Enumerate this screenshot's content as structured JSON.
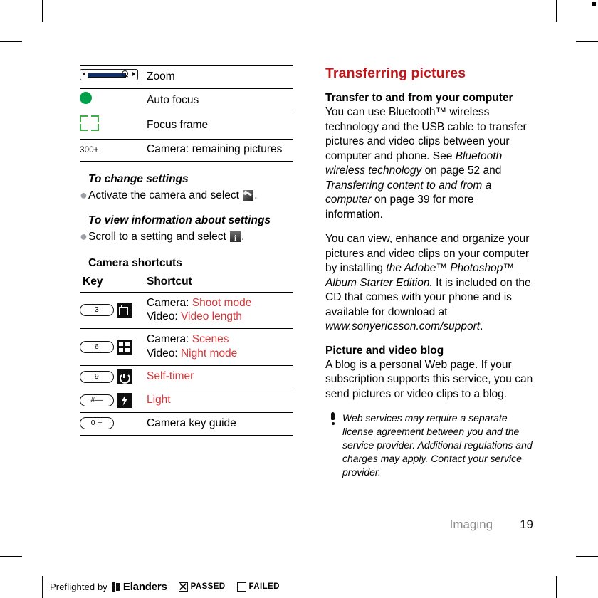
{
  "page": {
    "section_label": "Imaging",
    "page_number": "19"
  },
  "legend_table": {
    "rows": [
      {
        "icon": "zoom-slider-icon",
        "label": "Zoom"
      },
      {
        "icon": "green-dot-icon",
        "label": "Auto focus"
      },
      {
        "icon": "focus-frame-icon",
        "label": "Focus frame"
      },
      {
        "icon": "remaining-count-icon",
        "icon_text": "300+",
        "label": "Camera: remaining pictures"
      }
    ]
  },
  "procedures": [
    {
      "heading": "To change settings",
      "text_before": "Activate the camera and select ",
      "glyph": "wrench-icon",
      "text_after": "."
    },
    {
      "heading": "To view information about settings",
      "text_before": "Scroll to a setting and select ",
      "glyph": "info-icon",
      "text_after": "."
    }
  ],
  "shortcuts": {
    "title": "Camera shortcuts",
    "columns": [
      "Key",
      "Shortcut"
    ],
    "rows": [
      {
        "key": "3",
        "key_icon": "shoot-mode-icon",
        "lines": [
          {
            "label": "Camera:",
            "value": "Shoot mode"
          },
          {
            "label": "Video:",
            "value": "Video length"
          }
        ]
      },
      {
        "key": "6",
        "key_icon": "scenes-grid-icon",
        "lines": [
          {
            "label": "Camera:",
            "value": "Scenes"
          },
          {
            "label": "Video:",
            "value": "Night mode"
          }
        ]
      },
      {
        "key": "9",
        "key_icon": "self-timer-icon",
        "lines": [
          {
            "label": "",
            "value": "Self-timer"
          }
        ]
      },
      {
        "key": "#—",
        "key_icon": "light-bolt-icon",
        "lines": [
          {
            "label": "",
            "value": "Light"
          }
        ]
      },
      {
        "key": "0 +",
        "key_icon": "",
        "lines": [
          {
            "label": "Camera key guide",
            "value": ""
          }
        ]
      }
    ]
  },
  "right_column": {
    "chapter_title": "Transferring pictures",
    "section1": {
      "heading": "Transfer to and from your computer",
      "paragraph1_a": "You can use Bluetooth™ wireless technology and the USB cable to transfer pictures and video clips between your computer and phone. See ",
      "paragraph1_it1": "Bluetooth wireless technology",
      "paragraph1_b": " on page 52 and ",
      "paragraph1_it2": "Transferring content to and from a computer",
      "paragraph1_c": " on page 39 for more information.",
      "paragraph2_a": "You can view, enhance and organize your pictures and video clips on your computer by installing ",
      "paragraph2_it1": "the Adobe™ Photoshop™ Album Starter Edition.",
      "paragraph2_b": " It is included on the CD that comes with your phone and is available for download at ",
      "paragraph2_it2": "www.sonyericsson.com/support",
      "paragraph2_c": "."
    },
    "section2": {
      "heading": "Picture and video blog",
      "paragraph": "A blog is a personal Web page. If your subscription supports this service, you can send pictures or video clips to a blog."
    },
    "note": {
      "icon": "exclamation-icon",
      "text": "Web services may require a separate license agreement between you and the service provider. Additional regulations and charges may apply. Contact your service provider."
    }
  },
  "preflight": {
    "prefix": "Preflighted by",
    "brand": "Elanders",
    "passed_label": "PASSED",
    "failed_label": "FAILED"
  },
  "colors": {
    "chapter_red": "#C3161C",
    "shortcut_red": "#D6373B",
    "green_dot": "#00A14B",
    "focus_frame_green": "#3FAE49",
    "footer_gray": "#8A8A8A"
  }
}
